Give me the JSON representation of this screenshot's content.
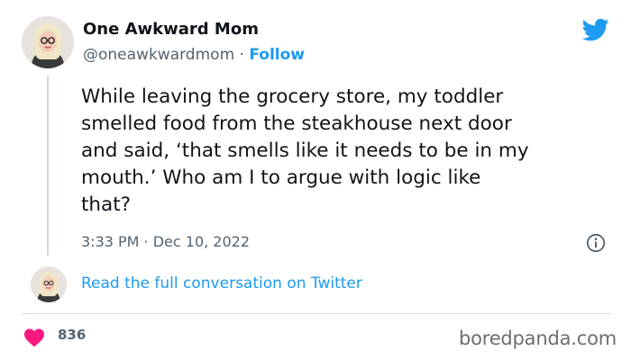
{
  "author": {
    "display_name": "One Awkward Mom",
    "handle": "@oneawkwardmom",
    "separator": " · ",
    "follow_label": "Follow"
  },
  "tweet": {
    "text": "While leaving the grocery store, my toddler\nsmelled food from the steakhouse next door\nand said, ‘that smells like it needs to be in my\nmouth.’ Who am I to argue with logic like\nthat?",
    "timestamp": "3:33 PM · Dec 10, 2022"
  },
  "conversation_link": "Read the full conversation on Twitter",
  "likes": {
    "count": "836",
    "icon": "heart-icon"
  },
  "watermark": "boredpanda.com",
  "icons": {
    "brand": "twitter-bird-icon",
    "info": "info-icon"
  },
  "colors": {
    "accent": "#1d9bf0",
    "text": "#0f1419",
    "muted": "#536471",
    "heart": "#f91880",
    "divider": "#cfd9de"
  }
}
